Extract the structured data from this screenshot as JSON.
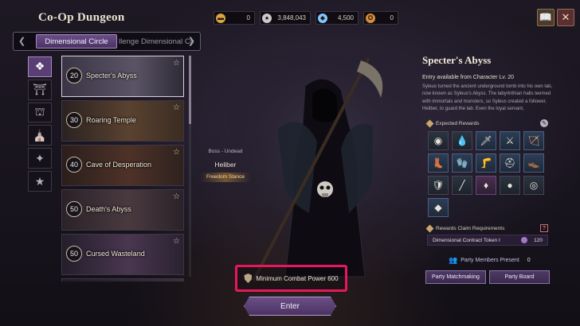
{
  "header": {
    "title": "Co-Op Dungeon",
    "currencies": [
      {
        "icon": "gold-bar-icon",
        "value": "0",
        "color": "#d9a441"
      },
      {
        "icon": "silver-coin-icon",
        "value": "3,848,043",
        "color": "#c9c9c9"
      },
      {
        "icon": "diamond-icon",
        "value": "4,500",
        "color": "#7fc8ff"
      },
      {
        "icon": "medal-icon",
        "value": "0",
        "color": "#d98c3a"
      }
    ],
    "book_icon": "book-icon",
    "close_icon": "close-icon"
  },
  "tabs": [
    {
      "label": "Dimensional Circle",
      "active": true
    },
    {
      "label": "llenge Dimensional Circle",
      "active": false
    }
  ],
  "sidebar": [
    {
      "icon": "all-dungeons-icon",
      "glyph": "❖",
      "active": true
    },
    {
      "icon": "gate-icon",
      "glyph": "⛩",
      "active": false
    },
    {
      "icon": "gate-plus-icon",
      "glyph": "⛫",
      "active": false
    },
    {
      "icon": "gate-double-icon",
      "glyph": "⛪",
      "active": false
    },
    {
      "icon": "sparkle-icon",
      "glyph": "✦",
      "active": false
    },
    {
      "icon": "favorite-star-icon",
      "glyph": "★",
      "active": false
    }
  ],
  "dungeons": [
    {
      "level": "20",
      "name": "Specter's Abyss",
      "selected": true,
      "tint": "#4b4555"
    },
    {
      "level": "30",
      "name": "Roaring Temple",
      "selected": false,
      "tint": "#4a3a2c"
    },
    {
      "level": "40",
      "name": "Cave of Desperation",
      "selected": false,
      "tint": "#3e2c26"
    },
    {
      "level": "50",
      "name": "Death's Abyss",
      "selected": false,
      "tint": "#3c3038"
    },
    {
      "level": "50",
      "name": "Cursed Wasteland",
      "selected": false,
      "tint": "#3a2e40"
    }
  ],
  "boss": {
    "type": "Boss - Undead",
    "name": "Heliber",
    "stance": "Freedom Stance"
  },
  "combat_power": "Minimum Combat Power 600",
  "enter_label": "Enter",
  "detail": {
    "title": "Specter's Abyss",
    "entry": "Entry available from Character Lv. 20",
    "description": "Syleus turned the ancient underground tomb into his own lab, now known as Syleus's Abyss. The labyrinthian halls teemed with immortals and monsters, so Syleus created a follower, Heliber, to guard the lab. Even the loyal servant,",
    "rewards_label": "Expected Rewards",
    "rewards": [
      {
        "icon": "orb-icon",
        "glyph": "◉",
        "style": "plain"
      },
      {
        "icon": "water-drop-icon",
        "glyph": "💧",
        "style": "plain"
      },
      {
        "icon": "dagger-icon",
        "glyph": "🗡",
        "style": "blue"
      },
      {
        "icon": "sword-icon",
        "glyph": "⚔",
        "style": "blue"
      },
      {
        "icon": "bow-icon",
        "glyph": "🏹",
        "style": "blue"
      },
      {
        "icon": "boots-icon",
        "glyph": "👢",
        "style": "blue"
      },
      {
        "icon": "gloves-icon",
        "glyph": "🧤",
        "style": "blue"
      },
      {
        "icon": "greaves-icon",
        "glyph": "🦵",
        "style": "blue"
      },
      {
        "icon": "helmet-icon",
        "glyph": "⛑",
        "style": "blue"
      },
      {
        "icon": "leather-boots-icon",
        "glyph": "👞",
        "style": "blue"
      },
      {
        "icon": "armor-icon",
        "glyph": "🛡",
        "style": "plain"
      },
      {
        "icon": "staff-icon",
        "glyph": "╱",
        "style": "plain"
      },
      {
        "icon": "gem-icon",
        "glyph": "♦",
        "style": "purple"
      },
      {
        "icon": "stone-icon",
        "glyph": "●",
        "style": "plain"
      },
      {
        "icon": "ring-icon",
        "glyph": "◎",
        "style": "plain"
      },
      {
        "icon": "crystal-icon",
        "glyph": "◆",
        "style": "blue"
      }
    ],
    "claim_label": "Rewards Claim Requirements",
    "token_name": "Dimensional Contract Token I",
    "token_count": "120",
    "party_label": "Party Members Present",
    "party_count": "0",
    "matchmaking_label": "Party Matchmaking",
    "board_label": "Party Board"
  },
  "colors": {
    "accent": "#5e4379",
    "highlight_box": "#e8175d",
    "gold_text": "#f3d99a"
  }
}
